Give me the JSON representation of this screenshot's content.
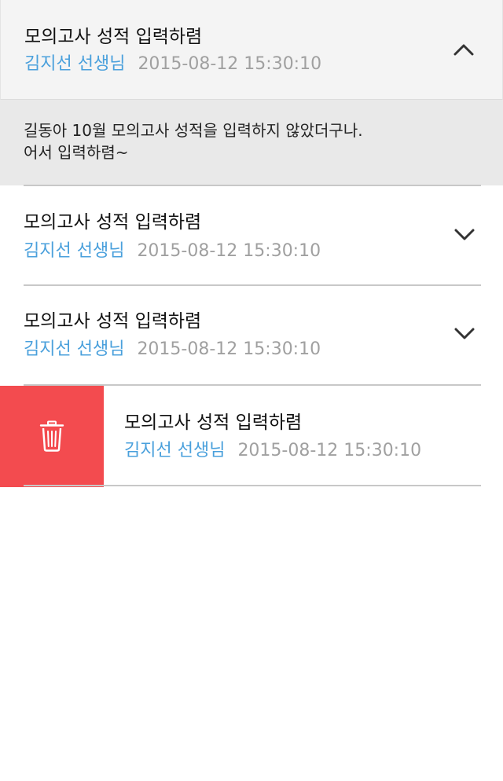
{
  "notices": [
    {
      "title": "모의고사 성적 입력하렴",
      "author": "김지선 선생님",
      "date": "2015-08-12 15:30:10",
      "expanded": true,
      "body": "길동아 10월 모의고사 성적을 입력하지 않았더구나.\n어서 입력하렴~",
      "toggle_icon": "chevron-up-icon"
    },
    {
      "title": "모의고사 성적 입력하렴",
      "author": "김지선 선생님",
      "date": "2015-08-12 15:30:10",
      "expanded": false,
      "toggle_icon": "chevron-down-icon"
    },
    {
      "title": "모의고사 성적 입력하렴",
      "author": "김지선 선생님",
      "date": "2015-08-12 15:30:10",
      "expanded": false,
      "toggle_icon": "chevron-down-icon"
    },
    {
      "title": "모의고사 성적 입력하렴",
      "author": "김지선 선생님",
      "date": "2015-08-12 15:30:10",
      "expanded": false,
      "swiped": true,
      "action_icon": "trash-icon"
    }
  ],
  "colors": {
    "author": "#4aa0dc",
    "date": "#a0a0a0",
    "delete_bg": "#f34b4f",
    "header_bg": "#f4f4f4",
    "body_bg": "#e9e9e9"
  }
}
